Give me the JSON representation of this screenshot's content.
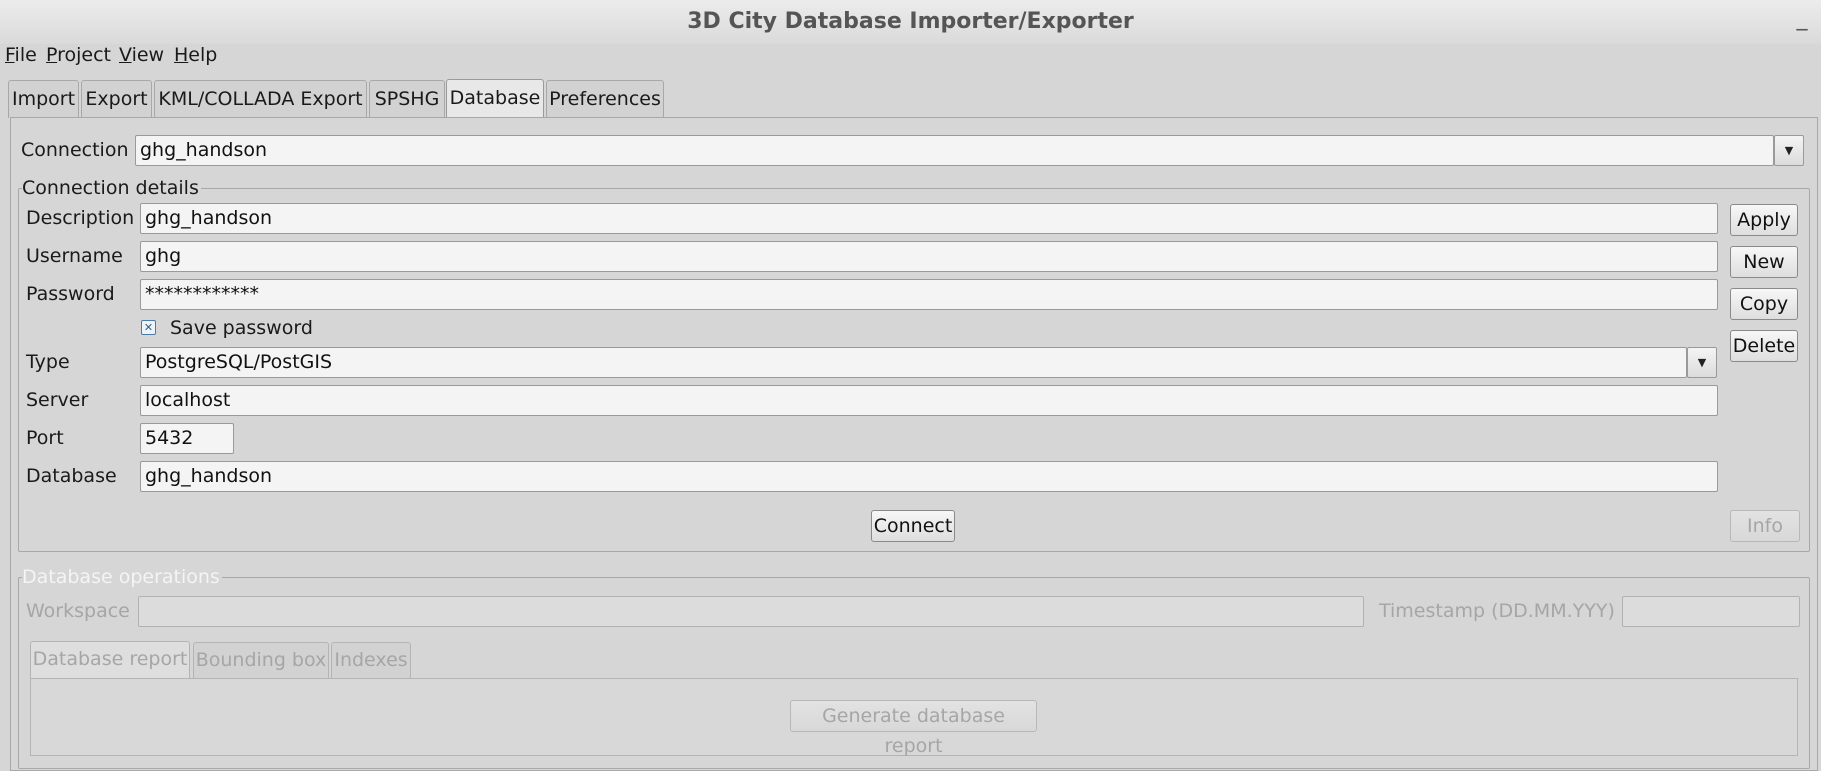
{
  "window": {
    "title": "3D City Database Importer/Exporter",
    "minimize_glyph": "_"
  },
  "menu": [
    {
      "mnemonic": "F",
      "rest": "ile"
    },
    {
      "mnemonic": "P",
      "rest": "roject"
    },
    {
      "mnemonic": "V",
      "rest": "iew"
    },
    {
      "mnemonic": "H",
      "rest": "elp"
    }
  ],
  "tabs": [
    "Import",
    "Export",
    "KML/COLLADA Export",
    "SPSHG",
    "Database",
    "Preferences"
  ],
  "active_tab": "Database",
  "connection": {
    "label": "Connection",
    "value": "ghg_handson"
  },
  "details": {
    "title": "Connection details",
    "description_label": "Description",
    "description": "ghg_handson",
    "username_label": "Username",
    "username": "ghg",
    "password_label": "Password",
    "password": "************",
    "save_password_label": "Save password",
    "save_password_checked": true,
    "type_label": "Type",
    "type": "PostgreSQL/PostGIS",
    "server_label": "Server",
    "server": "localhost",
    "port_label": "Port",
    "port": "5432",
    "database_label": "Database",
    "database": "ghg_handson",
    "buttons": {
      "apply": "Apply",
      "new": "New",
      "copy": "Copy",
      "delete": "Delete",
      "connect": "Connect",
      "info": "Info"
    }
  },
  "operations": {
    "title": "Database operations",
    "workspace_label": "Workspace",
    "workspace": "",
    "timestamp_label": "Timestamp (DD.MM.YYY)",
    "timestamp": "",
    "subtabs": [
      "Database report",
      "Bounding box",
      "Indexes"
    ],
    "active_subtab": "Database report",
    "generate_button": "Generate database report"
  },
  "icons": {
    "dropdown": "chevron-down-icon",
    "checkbox": "checkbox-checked-icon",
    "minimize": "minimize-icon"
  }
}
